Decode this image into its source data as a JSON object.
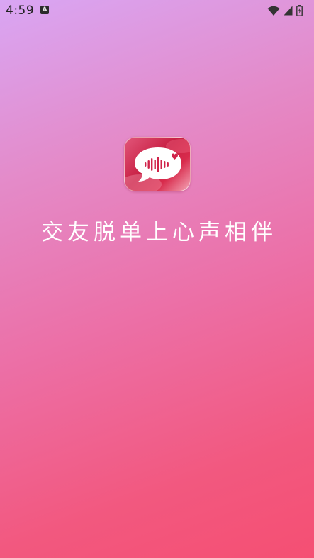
{
  "status_bar": {
    "time": "4:59",
    "notification_glyph": "A",
    "icons": [
      "notification-a-icon",
      "wifi-icon",
      "cell-signal-icon",
      "battery-charging-icon"
    ]
  },
  "splash": {
    "app_icon": "voice-chat-bubble-heart-logo",
    "slogan": "交友脱单上心声相伴"
  },
  "colors": {
    "background_top": "#d9a6f4",
    "background_bottom": "#f54f73",
    "logo_red": "#c81f43",
    "slogan_text": "#ffffff"
  }
}
